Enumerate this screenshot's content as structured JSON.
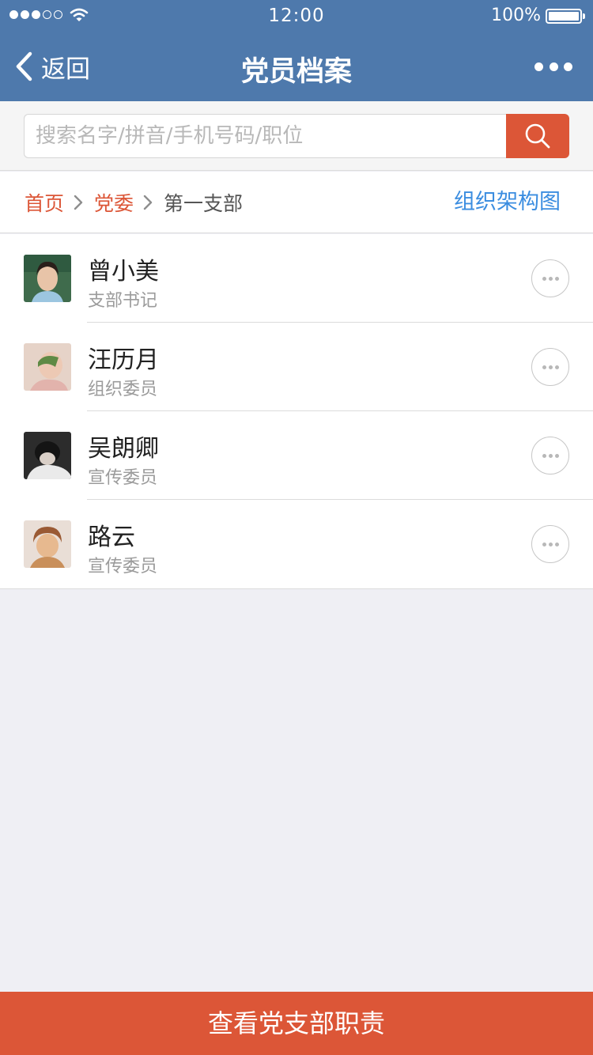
{
  "status_bar": {
    "time": "12:00",
    "battery": "100%",
    "signal_bars_filled": 3,
    "signal_bars_total": 5,
    "icons": [
      "signal-icon",
      "wifi-icon",
      "battery-icon"
    ]
  },
  "nav": {
    "back_label": "返回",
    "title": "党员档案",
    "more_icon": "more-dots-icon"
  },
  "search": {
    "placeholder": "搜索名字/拼音/手机号码/职位",
    "icon": "search-icon"
  },
  "breadcrumb": {
    "items": [
      {
        "label": "首页"
      },
      {
        "label": "党委"
      },
      {
        "label": "第一支部"
      }
    ],
    "separator_icon": "chevron-right-icon",
    "org_chart_link": "组织架构图"
  },
  "members": [
    {
      "name": "曾小美",
      "role": "支部书记",
      "avatar": "avatar-photo"
    },
    {
      "name": "汪历月",
      "role": "组织委员",
      "avatar": "avatar-photo"
    },
    {
      "name": "吴朗卿",
      "role": "宣传委员",
      "avatar": "avatar-photo"
    },
    {
      "name": "路云",
      "role": "宣传委员",
      "avatar": "avatar-photo"
    }
  ],
  "footer": {
    "button_label": "查看党支部职责"
  },
  "colors": {
    "nav_bg": "#4e79ac",
    "accent": "#dc5637",
    "link_blue": "#3b8de0",
    "page_bg": "#efeff4"
  }
}
